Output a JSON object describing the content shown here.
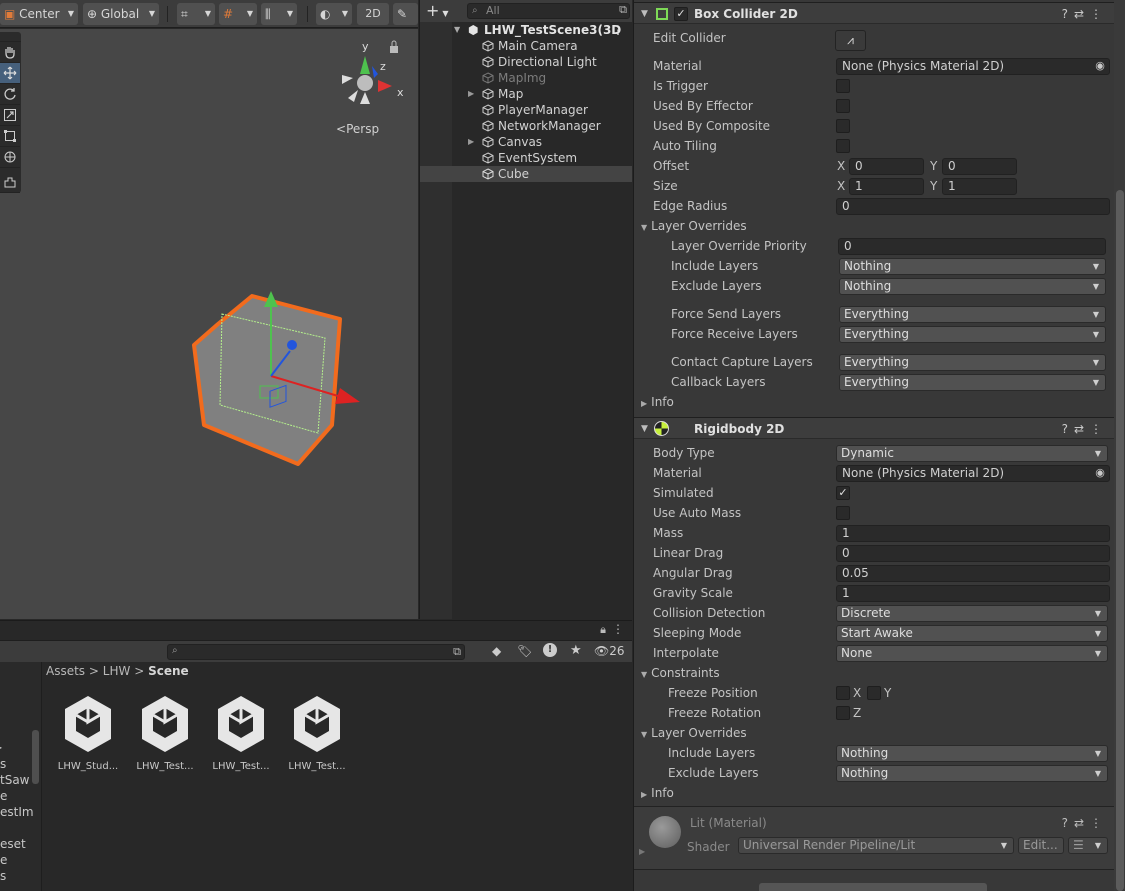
{
  "scene_toolbar": {
    "pivot_label": "Center",
    "space_label": "Global",
    "mode_2d_label": "2D"
  },
  "scene_view": {
    "persp_label": "Persp",
    "axis_y": "y",
    "axis_z": "z",
    "axis_x": "x"
  },
  "hierarchy": {
    "search_placeholder": "All",
    "scene_name": "LHW_TestScene3(3D",
    "items": [
      {
        "label": "Main Camera"
      },
      {
        "label": "Directional Light"
      },
      {
        "label": "MapImg"
      },
      {
        "label": "Map"
      },
      {
        "label": "PlayerManager"
      },
      {
        "label": "NetworkManager"
      },
      {
        "label": "Canvas"
      },
      {
        "label": "EventSystem"
      },
      {
        "label": "Cube"
      }
    ]
  },
  "project": {
    "breadcrumb": {
      "root": "Assets",
      "sep": ">",
      "mid": "LHW",
      "current": "Scene"
    },
    "hidden_count": "26",
    "left_items": [
      "s",
      "tSaw",
      "e",
      "estIm",
      "eset",
      "e",
      "s"
    ],
    "assets": [
      {
        "label": "LHW_Stud..."
      },
      {
        "label": "LHW_Test..."
      },
      {
        "label": "LHW_Test..."
      },
      {
        "label": "LHW_Test..."
      }
    ]
  },
  "box_collider": {
    "title": "Box Collider 2D",
    "edit_collider_label": "Edit Collider",
    "material_label": "Material",
    "material_value": "None (Physics Material 2D)",
    "is_trigger_label": "Is Trigger",
    "used_by_effector_label": "Used By Effector",
    "used_by_composite_label": "Used By Composite",
    "auto_tiling_label": "Auto Tiling",
    "offset_label": "Offset",
    "offset_x": "0",
    "offset_y": "0",
    "size_label": "Size",
    "size_x": "1",
    "size_y": "1",
    "edge_radius_label": "Edge Radius",
    "edge_radius_value": "0",
    "layer_overrides_label": "Layer Overrides",
    "layer_override_priority_label": "Layer Override Priority",
    "layer_override_priority_value": "0",
    "include_layers_label": "Include Layers",
    "include_layers_value": "Nothing",
    "exclude_layers_label": "Exclude Layers",
    "exclude_layers_value": "Nothing",
    "force_send_label": "Force Send Layers",
    "force_send_value": "Everything",
    "force_receive_label": "Force Receive Layers",
    "force_receive_value": "Everything",
    "contact_capture_label": "Contact Capture Layers",
    "contact_capture_value": "Everything",
    "callback_label": "Callback Layers",
    "callback_value": "Everything",
    "info_label": "Info"
  },
  "rigidbody": {
    "title": "Rigidbody 2D",
    "body_type_label": "Body Type",
    "body_type_value": "Dynamic",
    "material_label": "Material",
    "material_value": "None (Physics Material 2D)",
    "simulated_label": "Simulated",
    "use_auto_mass_label": "Use Auto Mass",
    "mass_label": "Mass",
    "mass_value": "1",
    "linear_drag_label": "Linear Drag",
    "linear_drag_value": "0",
    "angular_drag_label": "Angular Drag",
    "angular_drag_value": "0.05",
    "gravity_scale_label": "Gravity Scale",
    "gravity_scale_value": "1",
    "collision_detection_label": "Collision Detection",
    "collision_detection_value": "Discrete",
    "sleeping_mode_label": "Sleeping Mode",
    "sleeping_mode_value": "Start Awake",
    "interpolate_label": "Interpolate",
    "interpolate_value": "None",
    "constraints_label": "Constraints",
    "freeze_position_label": "Freeze Position",
    "freeze_rotation_label": "Freeze Rotation",
    "axis_x": "X",
    "axis_y": "Y",
    "axis_z": "Z",
    "layer_overrides_label": "Layer Overrides",
    "include_layers_label": "Include Layers",
    "include_layers_value": "Nothing",
    "exclude_layers_label": "Exclude Layers",
    "exclude_layers_value": "Nothing",
    "info_label": "Info"
  },
  "material_section": {
    "title": "Lit (Material)",
    "shader_label": "Shader",
    "shader_value": "Universal Render Pipeline/Lit",
    "edit_label": "Edit..."
  },
  "colors": {
    "accent_selection": "#46607c",
    "cube_outline": "#f26b1d",
    "gizmo_y": "#4ec24e",
    "gizmo_x": "#d22",
    "gizmo_z": "#2255dd"
  }
}
